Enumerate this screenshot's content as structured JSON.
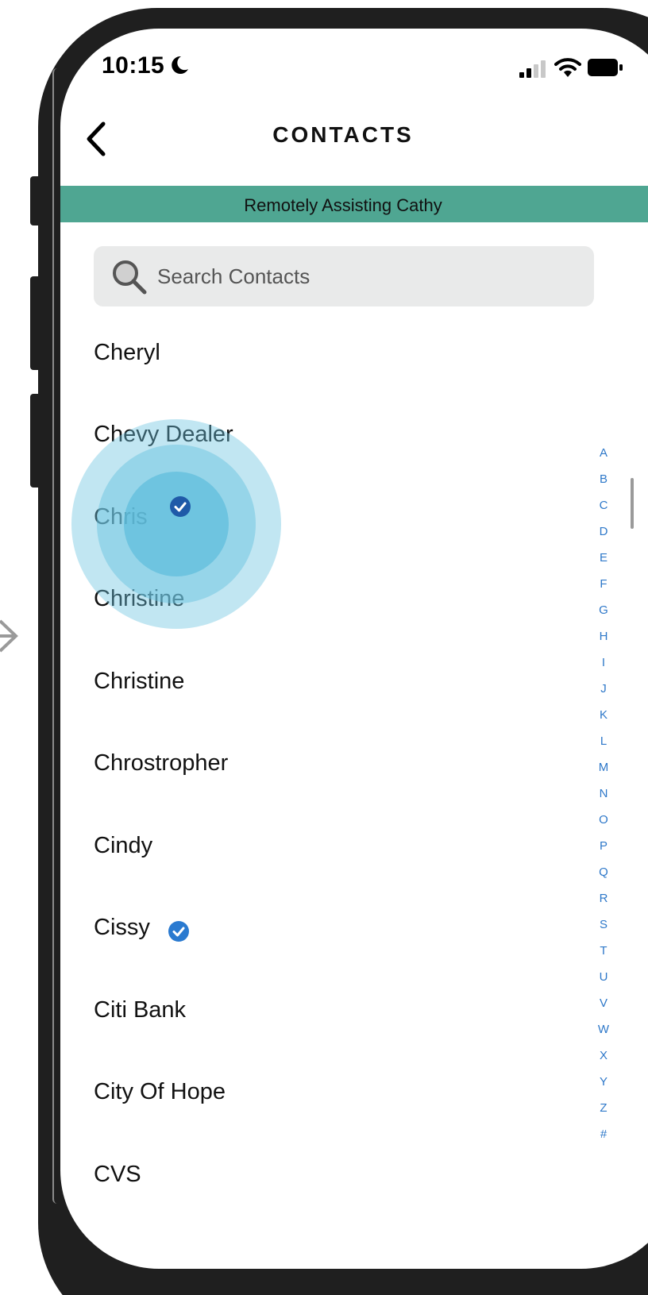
{
  "status_bar": {
    "time": "10:15",
    "icons": [
      "moon-icon",
      "signal-icon",
      "wifi-icon",
      "battery-icon"
    ]
  },
  "header": {
    "title": "CONTACTS",
    "back_icon": "chevron-left-icon"
  },
  "banner": {
    "text": "Remotely Assisting Cathy",
    "color": "#4fa692"
  },
  "search": {
    "placeholder": "Search Contacts",
    "value": ""
  },
  "contacts": [
    {
      "name": "Cheryl",
      "verified": false
    },
    {
      "name": "Chevy Dealer",
      "verified": false
    },
    {
      "name": "Chris",
      "verified": true
    },
    {
      "name": "Christine",
      "verified": false
    },
    {
      "name": "Christine",
      "verified": false
    },
    {
      "name": "Chrostropher",
      "verified": false
    },
    {
      "name": "Cindy",
      "verified": false
    },
    {
      "name": "Cissy",
      "verified": true
    },
    {
      "name": "Citi Bank",
      "verified": false
    },
    {
      "name": "City Of Hope",
      "verified": false
    },
    {
      "name": "CVS",
      "verified": false
    }
  ],
  "alpha_index": [
    "A",
    "B",
    "C",
    "D",
    "E",
    "F",
    "G",
    "H",
    "I",
    "J",
    "K",
    "L",
    "M",
    "N",
    "O",
    "P",
    "Q",
    "R",
    "S",
    "T",
    "U",
    "V",
    "W",
    "X",
    "Y",
    "Z",
    "#"
  ],
  "colors": {
    "accent_blue": "#2e78c9",
    "verified_blue": "#2a6bbf",
    "tap_highlight": "#6cc4df"
  }
}
